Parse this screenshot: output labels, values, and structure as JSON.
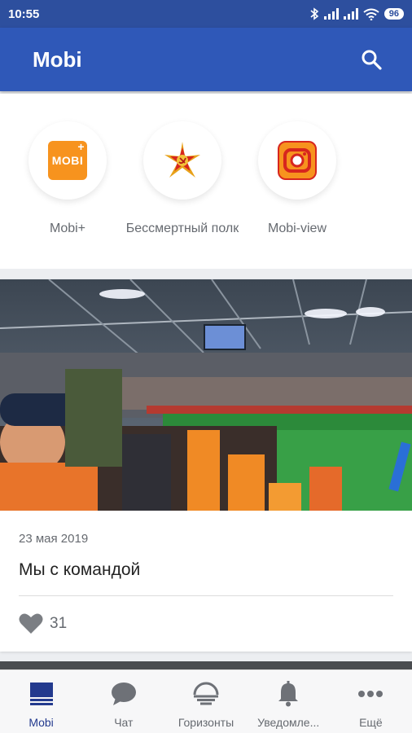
{
  "status_bar": {
    "time": "10:55",
    "battery": "96"
  },
  "app_bar": {
    "title": "Mobi",
    "search_icon": "search-icon"
  },
  "shortcuts": [
    {
      "label": "Mobi+",
      "icon": "mobi-plus-icon",
      "logo_text": "MOBI",
      "logo_badge": "+"
    },
    {
      "label": "Бессмертный полк",
      "icon": "immortal-regiment-icon"
    },
    {
      "label": "Mobi-view",
      "icon": "mobi-view-icon"
    }
  ],
  "news": {
    "date": "23 мая 2019",
    "title": "Мы с командой",
    "likes": "31"
  },
  "bottom_nav": [
    {
      "label": "Mobi",
      "icon": "mobi-icon",
      "active": true
    },
    {
      "label": "Чат",
      "icon": "chat-icon"
    },
    {
      "label": "Горизонты",
      "icon": "horizons-icon"
    },
    {
      "label": "Уведомле...",
      "icon": "bell-icon"
    },
    {
      "label": "Ещё",
      "icon": "more-icon"
    }
  ],
  "colors": {
    "status_bar": "#2d4f9e",
    "app_bar": "#2f58b8",
    "accent_orange": "#f7931e",
    "nav_active": "#233a8e"
  }
}
